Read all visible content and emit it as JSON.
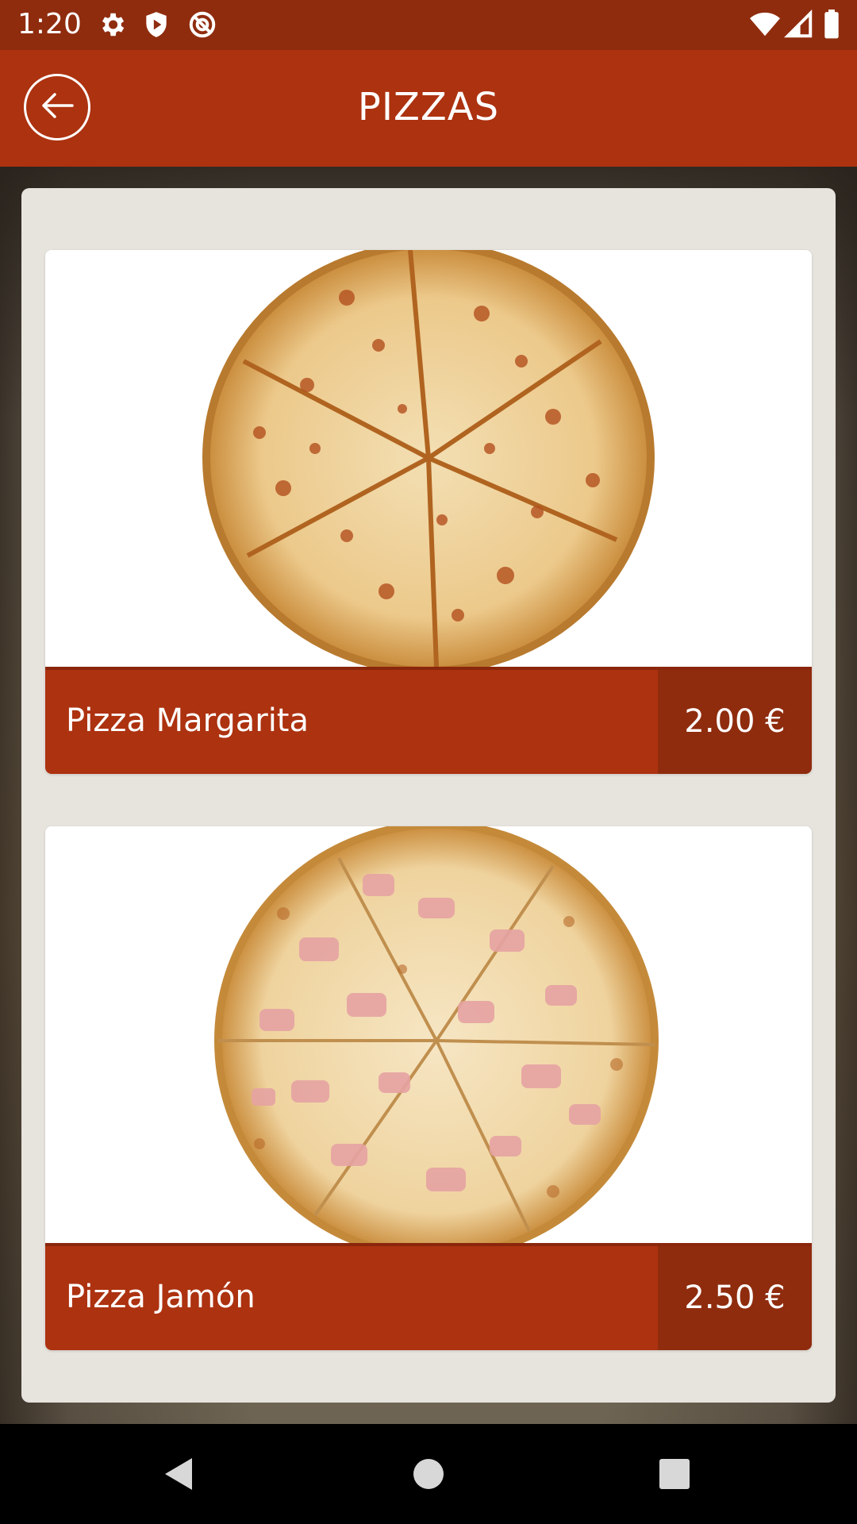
{
  "status_bar": {
    "time": "1:20",
    "left_icons": [
      "gear-icon",
      "shield-play-icon",
      "no-location-icon"
    ],
    "right_icons": [
      "wifi-icon",
      "signal-icon",
      "battery-icon"
    ]
  },
  "app_bar": {
    "title": "PIZZAS",
    "back_icon": "arrow-left-circle-icon",
    "color": "#ad3210"
  },
  "products": [
    {
      "name": "Pizza Margarita",
      "price": "2.00 €",
      "image": "pizza-margarita-photo"
    },
    {
      "name": "Pizza Jamón",
      "price": "2.50 €",
      "image": "pizza-jamon-photo"
    }
  ],
  "nav_bar": {
    "icons": [
      "back-triangle-icon",
      "home-circle-icon",
      "recents-square-icon"
    ]
  },
  "colors": {
    "status_bar": "#8f2c0e",
    "accent": "#ad3210",
    "price_block": "#8f2c0e",
    "panel": "#e7e3dd"
  }
}
